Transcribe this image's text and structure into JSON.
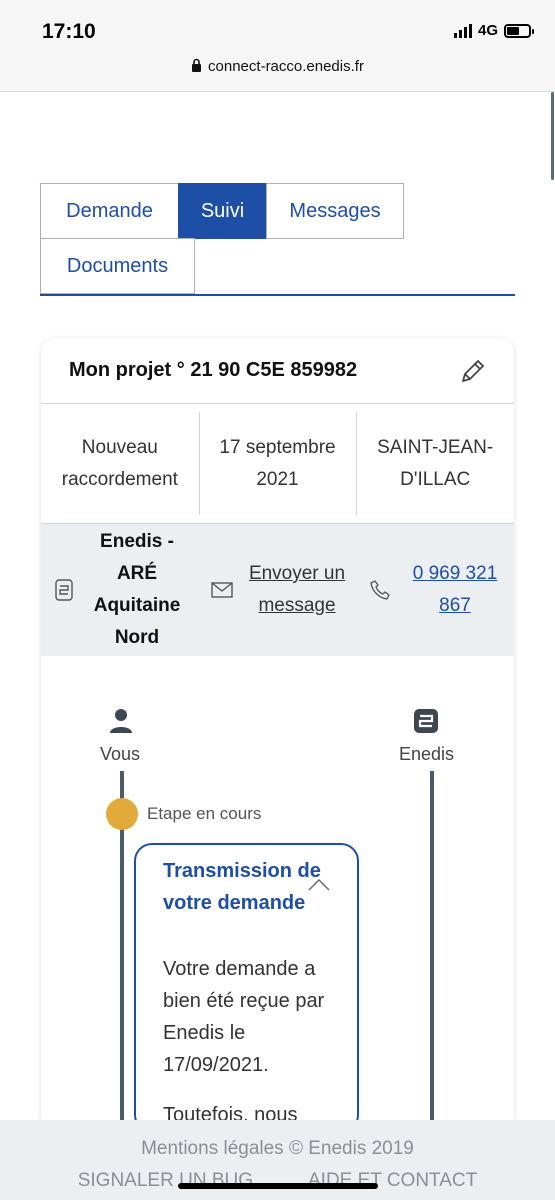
{
  "status_bar": {
    "time": "17:10",
    "network": "4G",
    "battery_level": 0.55
  },
  "browser": {
    "url": "connect-racco.enedis.fr"
  },
  "tabs": [
    {
      "label": "Demande",
      "active": false
    },
    {
      "label": "Suivi",
      "active": true
    },
    {
      "label": "Messages",
      "active": false
    },
    {
      "label": "Documents",
      "active": false
    }
  ],
  "project": {
    "title": "Mon projet ° 21 90 C5E 859982",
    "type": "Nouveau raccordement",
    "date": "17 septembre 2021",
    "city": "SAINT-JEAN-D'ILLAC"
  },
  "contact": {
    "name": "Enedis - ARÉ Aquitaine Nord",
    "message_link": "Envoyer un message",
    "phone": "0 969 321 867"
  },
  "timeline": {
    "left_label": "Vous",
    "right_label": "Enedis",
    "step_status": "Etape en cours",
    "step_title": "Transmission de votre demande",
    "step_text": "Votre demande a bien été reçue par Enedis le 17/09/2021.",
    "step_text_more": "Toutefois, nous"
  },
  "footer": {
    "legal": "Mentions légales © Enedis 2019",
    "report_bug": "SIGNALER UN BUG",
    "help": "AIDE ET CONTACT"
  },
  "colors": {
    "brand_blue": "#1d4fa6",
    "step_in_progress": "#e2a93b",
    "timeline_line": "#4d5a69",
    "panel_gray": "#eceff2"
  },
  "icons": {
    "lock": "lock-icon",
    "edit": "pencil-icon",
    "contact": "enedis-logo-icon",
    "mail": "envelope-icon",
    "phone": "phone-icon",
    "user": "user-icon",
    "chevron": "chevron-up-icon"
  }
}
